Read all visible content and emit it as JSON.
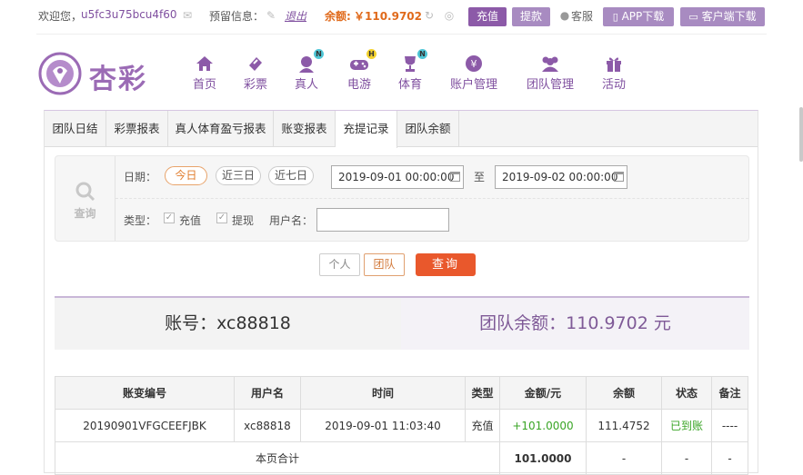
{
  "topbar": {
    "welcome_label": "欢迎您，",
    "username": "u5fc3u75bcu4f60",
    "reserved_info_label": "预留信息：",
    "logout_label": "退出",
    "balance_label": "余额:",
    "balance_value": "￥110.9702",
    "deposit_label": "充值",
    "withdraw_label": "提款",
    "service_label": "客服",
    "app_download_label": "APP下载",
    "client_download_label": "客户端下载"
  },
  "logo": {
    "text": "杏彩"
  },
  "nav": [
    {
      "label": "首页",
      "icon": "home-icon",
      "badge": ""
    },
    {
      "label": "彩票",
      "icon": "lottery-icon",
      "badge": ""
    },
    {
      "label": "真人",
      "icon": "live-casino-icon",
      "badge": "N"
    },
    {
      "label": "电游",
      "icon": "gamepad-icon",
      "badge": "H"
    },
    {
      "label": "体育",
      "icon": "trophy-icon",
      "badge": "N"
    },
    {
      "label": "账户管理",
      "icon": "account-icon",
      "badge": ""
    },
    {
      "label": "团队管理",
      "icon": "team-icon",
      "badge": ""
    },
    {
      "label": "活动",
      "icon": "gift-icon",
      "badge": ""
    }
  ],
  "tabs": [
    {
      "label": "团队日结",
      "active": false
    },
    {
      "label": "彩票报表",
      "active": false
    },
    {
      "label": "真人体育盈亏报表",
      "active": false
    },
    {
      "label": "账变报表",
      "active": false
    },
    {
      "label": "充提记录",
      "active": true
    },
    {
      "label": "团队余额",
      "active": false
    }
  ],
  "filter": {
    "query_label": "查询",
    "date_label": "日期：",
    "date_presets": [
      "今日",
      "近三日",
      "近七日"
    ],
    "start_date": "2019-09-01 00:00:00",
    "to_label": "至",
    "end_date": "2019-09-02 00:00:00",
    "type_label": "类型：",
    "type_deposit": "充值",
    "type_withdraw": "提现",
    "username_label": "用户名：",
    "username_value": ""
  },
  "scope": {
    "personal_label": "个人",
    "team_label": "团队",
    "search_label": "查询"
  },
  "summary": {
    "account_label": "账号：",
    "account_value": "xc88818",
    "team_balance_label": "团队余额：",
    "team_balance_value": "110.9702",
    "team_balance_unit": "元"
  },
  "table": {
    "headers": [
      "账变编号",
      "用户名",
      "时间",
      "类型",
      "金额/元",
      "余额",
      "状态",
      "备注"
    ],
    "rows": [
      [
        "20190901VFGCEEFJBK",
        "xc88818",
        "2019-09-01 11:03:40",
        "充值",
        "+101.0000",
        "111.4752",
        "已到账",
        "----"
      ]
    ],
    "footer": {
      "label": "本页合计",
      "amount": "101.0000",
      "balance": "-",
      "status": "-",
      "remark": "-"
    }
  },
  "colors": {
    "brand": "#8c5aa8",
    "accent": "#e9582c",
    "success": "#3aa526",
    "balance": "#e06a1b"
  }
}
